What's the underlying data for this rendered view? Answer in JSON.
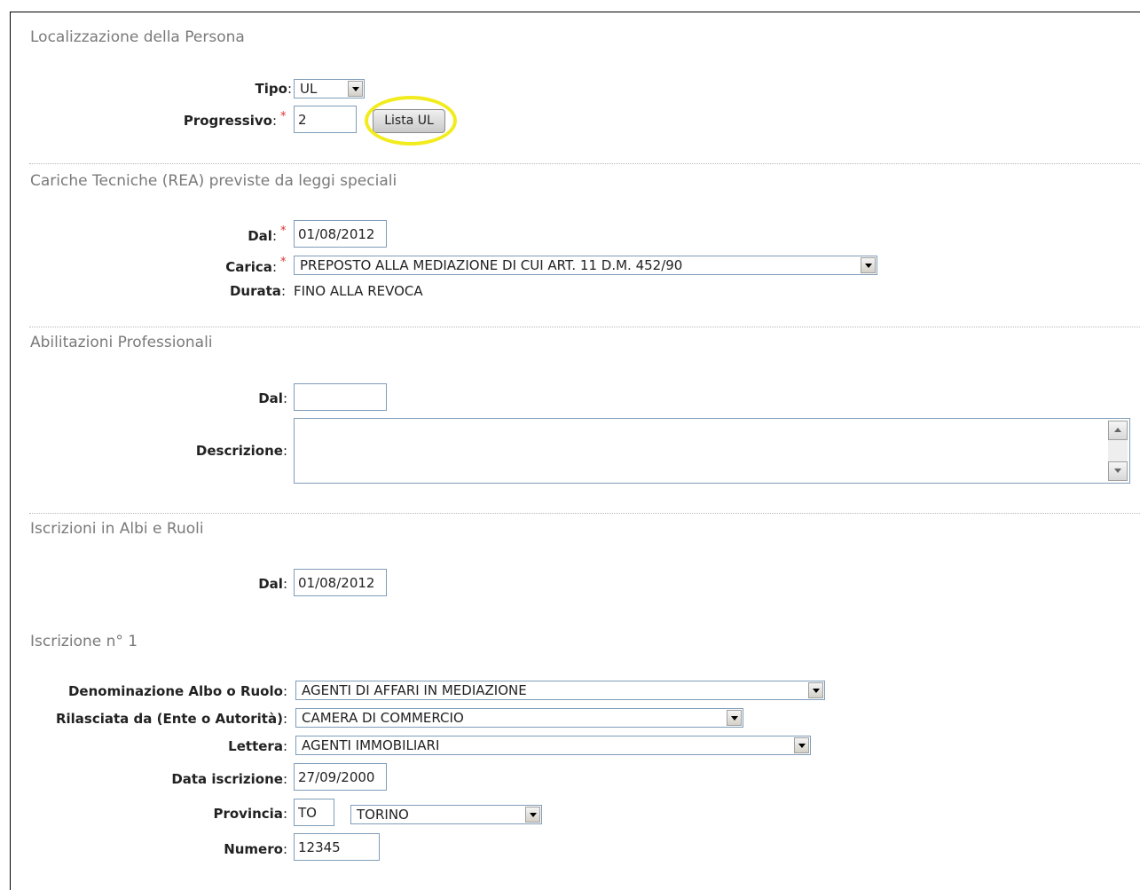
{
  "sections": {
    "localizzazione": "Localizzazione della Persona",
    "cariche": "Cariche Tecniche (REA) previste da leggi speciali",
    "abilitazioni": "Abilitazioni Professionali",
    "iscrizioni": "Iscrizioni in Albi e Ruoli",
    "iscrizione_n": "Iscrizione n° 1"
  },
  "localizzazione": {
    "tipo_label": "Tipo",
    "tipo_value": "UL",
    "progressivo_label": "Progressivo",
    "progressivo_value": "2",
    "lista_button": "Lista UL"
  },
  "cariche": {
    "dal_label": "Dal",
    "dal_value": "01/08/2012",
    "carica_label": "Carica",
    "carica_value": "PREPOSTO ALLA MEDIAZIONE DI CUI ART. 11 D.M. 452/90",
    "durata_label": "Durata",
    "durata_value": "FINO ALLA REVOCA"
  },
  "abilitazioni": {
    "dal_label": "Dal",
    "dal_value": "",
    "descrizione_label": "Descrizione",
    "descrizione_value": ""
  },
  "iscrizioni": {
    "dal_label": "Dal",
    "dal_value": "01/08/2012"
  },
  "iscrizione": {
    "denominazione_label": "Denominazione Albo o Ruolo",
    "denominazione_value": "AGENTI DI AFFARI IN MEDIAZIONE",
    "rilasciata_label": "Rilasciata da (Ente o Autorità)",
    "rilasciata_value": "CAMERA DI COMMERCIO",
    "lettera_label": "Lettera",
    "lettera_value": "AGENTI IMMOBILIARI",
    "data_label": "Data iscrizione",
    "data_value": "27/09/2000",
    "provincia_label": "Provincia",
    "provincia_code": "TO",
    "provincia_name": "TORINO",
    "numero_label": "Numero",
    "numero_value": "12345"
  },
  "colors": {
    "required": "#e03030",
    "highlight": "#f2ec1e",
    "section_title": "#7a7a7a",
    "input_border": "#7f9db9"
  }
}
